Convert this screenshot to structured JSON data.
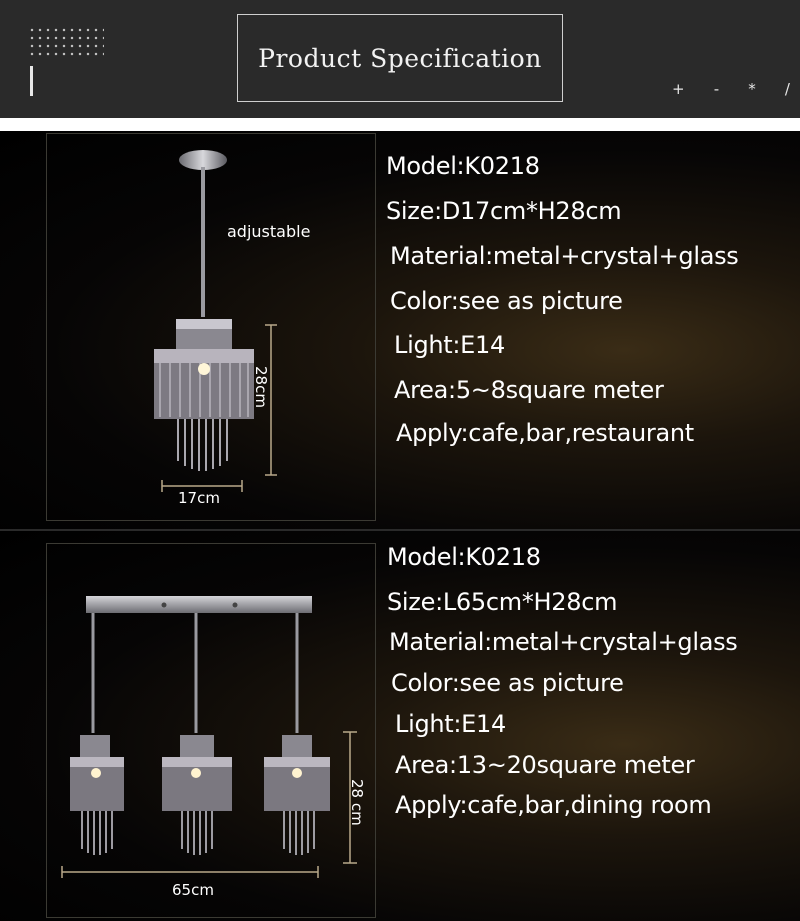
{
  "header": {
    "title": "Product Specification",
    "marks": [
      "+",
      "-",
      "*",
      "/"
    ]
  },
  "product1": {
    "labels": {
      "adjustable": "adjustable",
      "height": "28cm",
      "width": "17cm"
    },
    "specs": [
      "Model:K0218",
      "Size:D17cm*H28cm",
      "Material:metal+crystal+glass",
      "Color:see as picture",
      "Light:E14",
      "Area:5~8square meter",
      "Apply:cafe,bar,restaurant"
    ]
  },
  "product2": {
    "labels": {
      "height": "28 cm",
      "width": "65cm"
    },
    "specs": [
      "Model:K0218",
      "Size:L65cm*H28cm",
      "Material:metal+crystal+glass",
      "Color:see as picture",
      "Light:E14",
      "Area:13~20square meter",
      "Apply:cafe,bar,dining room"
    ]
  }
}
